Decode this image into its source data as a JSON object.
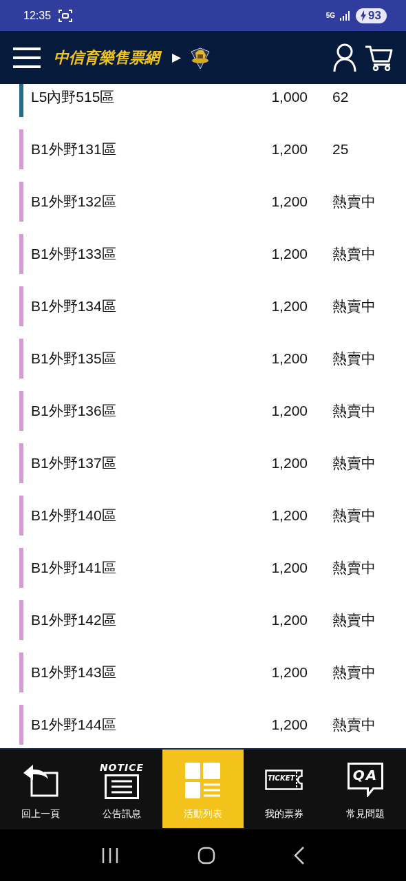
{
  "status_bar": {
    "time": "12:35",
    "network": "5G",
    "battery": "93"
  },
  "header": {
    "title": "中信育樂售票網",
    "arrow": "▶"
  },
  "seats": [
    {
      "name": "L5內野515區",
      "price": "1,000",
      "availability": "62",
      "color": "#1f6e8c"
    },
    {
      "name": "B1外野131區",
      "price": "1,200",
      "availability": "25",
      "color": "#d69ad6"
    },
    {
      "name": "B1外野132區",
      "price": "1,200",
      "availability": "熱賣中",
      "color": "#d69ad6"
    },
    {
      "name": "B1外野133區",
      "price": "1,200",
      "availability": "熱賣中",
      "color": "#d69ad6"
    },
    {
      "name": "B1外野134區",
      "price": "1,200",
      "availability": "熱賣中",
      "color": "#d69ad6"
    },
    {
      "name": "B1外野135區",
      "price": "1,200",
      "availability": "熱賣中",
      "color": "#d69ad6"
    },
    {
      "name": "B1外野136區",
      "price": "1,200",
      "availability": "熱賣中",
      "color": "#d69ad6"
    },
    {
      "name": "B1外野137區",
      "price": "1,200",
      "availability": "熱賣中",
      "color": "#d69ad6"
    },
    {
      "name": "B1外野140區",
      "price": "1,200",
      "availability": "熱賣中",
      "color": "#d69ad6"
    },
    {
      "name": "B1外野141區",
      "price": "1,200",
      "availability": "熱賣中",
      "color": "#d69ad6"
    },
    {
      "name": "B1外野142區",
      "price": "1,200",
      "availability": "熱賣中",
      "color": "#d69ad6"
    },
    {
      "name": "B1外野143區",
      "price": "1,200",
      "availability": "熱賣中",
      "color": "#d69ad6"
    },
    {
      "name": "B1外野144區",
      "price": "1,200",
      "availability": "熱賣中",
      "color": "#d69ad6"
    }
  ],
  "bottom_nav": [
    {
      "kind": "back",
      "label": "回上一頁",
      "selected": false
    },
    {
      "kind": "notice",
      "label": "公告訊息",
      "icon_text": "NOTICE",
      "selected": false
    },
    {
      "kind": "list",
      "label": "活動列表",
      "selected": true
    },
    {
      "kind": "ticket",
      "label": "我的票券",
      "icon_text": "TICKET",
      "selected": false
    },
    {
      "kind": "qa",
      "label": "常見問題",
      "icon_text": "QA",
      "selected": false
    }
  ]
}
